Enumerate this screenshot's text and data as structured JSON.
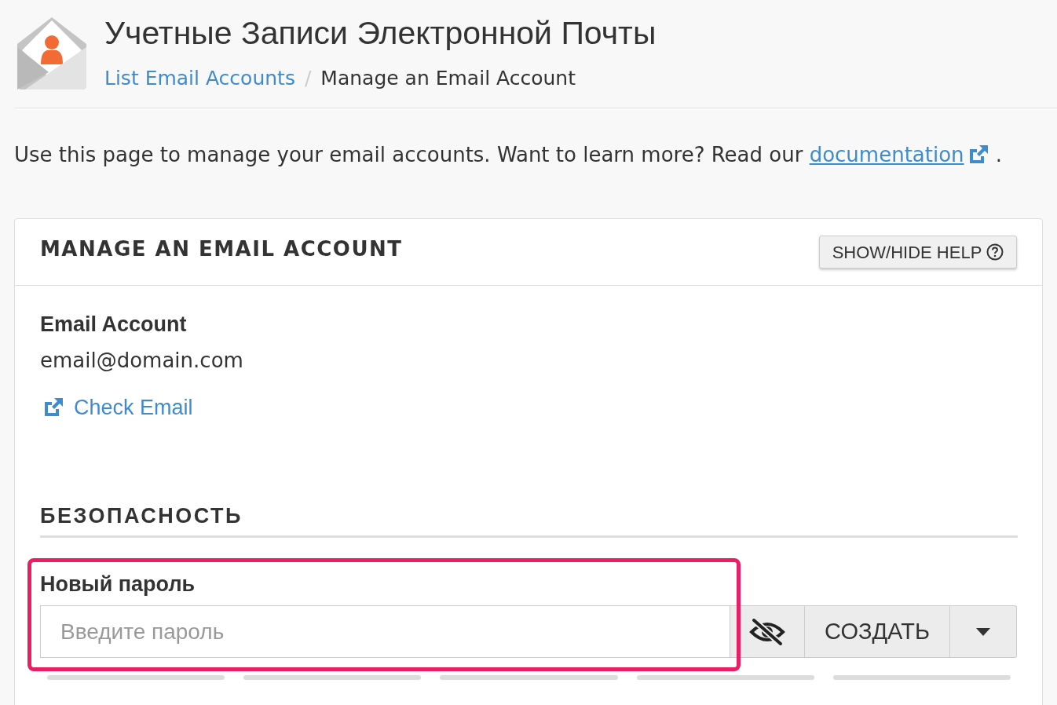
{
  "header": {
    "title": "Учетные Записи Электронной Почты",
    "breadcrumb": [
      {
        "label": "List Email Accounts",
        "kind": "link"
      },
      {
        "label": "/",
        "kind": "separator"
      },
      {
        "label": "Manage an Email Account",
        "kind": "current"
      }
    ]
  },
  "intro": {
    "text": "Use this page to manage your email accounts. Want to learn more? Read our",
    "link": "documentation",
    "end": "."
  },
  "panel": {
    "title": "MANAGE AN EMAIL ACCOUNT",
    "help_button": "SHOW/HIDE HELP",
    "account": {
      "label": "Email Account",
      "value": "email@domain.com",
      "check_email_link": "Check Email"
    },
    "security": {
      "heading": "БЕЗОПАСНОСТЬ",
      "password": {
        "label": "Новый пароль",
        "placeholder": "Введите пароль",
        "highlighted": true,
        "generate_button": "СОЗДАТЬ",
        "strength": {
          "level": 0
        }
      }
    }
  }
}
